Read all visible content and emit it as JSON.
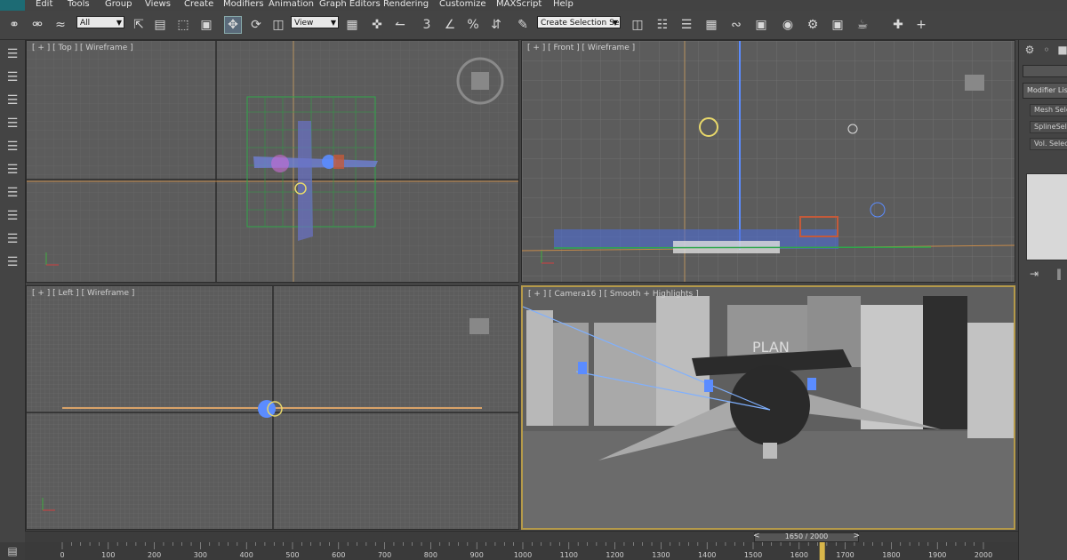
{
  "menu": [
    "Edit",
    "Tools",
    "Group",
    "Views",
    "Create",
    "Modifiers",
    "Animation",
    "Graph Editors",
    "Rendering",
    "Customize",
    "MAXScript",
    "Help"
  ],
  "toolbar": {
    "filter_value": "All",
    "view_value": "View",
    "selection_set_placeholder": "Create Selection Se",
    "snap_value": "3",
    "icons": [
      "link-icon",
      "unlink-icon",
      "bind-space-warp-icon",
      "select-object-icon",
      "select-by-name-icon",
      "rect-region-icon",
      "window-crossing-icon",
      "move-icon",
      "rotate-icon",
      "scale-icon",
      "pivot-icon",
      "select-manipulate-icon",
      "keyboard-shortcut-icon",
      "snap-icon",
      "angle-snap-icon",
      "percent-snap-icon",
      "spinner-snap-icon",
      "edit-named-sets-icon",
      "mirror-icon",
      "align-icon",
      "layer-manager-icon",
      "ribbon-icon",
      "curve-editor-icon",
      "schematic-view-icon",
      "material-editor-icon",
      "render-setup-icon",
      "render-frame-icon",
      "render-icon",
      "environment-icon",
      "render-iterative-icon",
      "teapot-render-icon",
      "plus-icon"
    ]
  },
  "viewports": {
    "top": "[ + ] [ Top ] [ Wireframe ]",
    "front": "[ + ] [ Front ] [ Wireframe ]",
    "left": "[ + ] [ Left ] [ Wireframe ]",
    "camera": "[ + ] [ Camera16 ] [ Smooth + Highlights ]"
  },
  "scene_sign": "PLAN",
  "command_panel": {
    "modifier_list": "Modifier List",
    "buttons": [
      "Mesh Select",
      "SplineSelect",
      "Vol. Select"
    ]
  },
  "time_slider": {
    "current": 1650,
    "total": 2000,
    "label": "1650 / 2000"
  },
  "timeline": {
    "ticks": [
      0,
      100,
      200,
      300,
      400,
      500,
      600,
      700,
      800,
      900,
      1000,
      1100,
      1200,
      1300,
      1400,
      1500,
      1600,
      1700,
      1800,
      1900,
      2000
    ]
  },
  "colors": {
    "accent": "#d8b64a",
    "grid": "#6a6a6a",
    "selection_blue": "#5b8cff"
  }
}
